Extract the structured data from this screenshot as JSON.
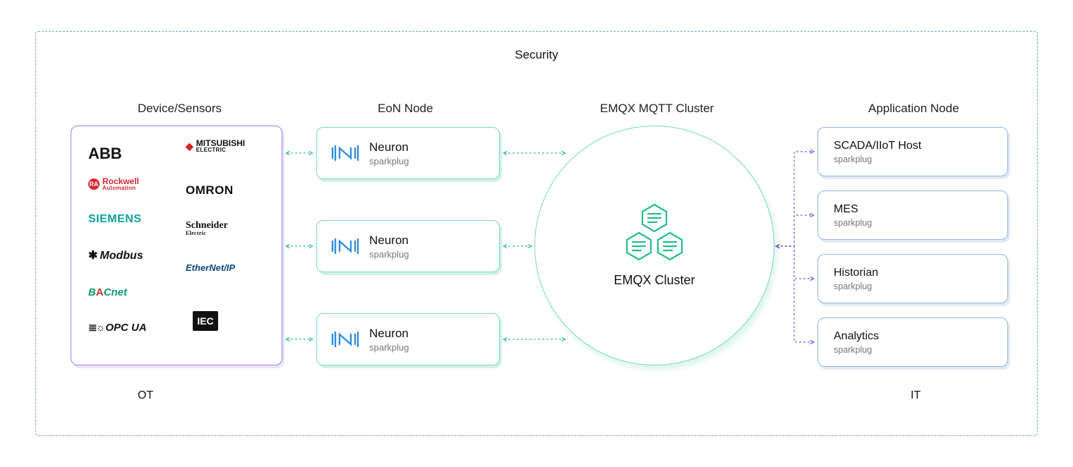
{
  "diagram": {
    "security_title": "Security",
    "columns": {
      "devices": "Device/Sensors",
      "eon": "EoN Node",
      "broker": "EMQX MQTT Cluster",
      "apps": "Application Node"
    },
    "bottom": {
      "ot": "OT",
      "it": "IT"
    },
    "devices": {
      "vendors": {
        "abb": "ABB",
        "mitsubishi_line1": "MITSUBISHI",
        "mitsubishi_line2": "ELECTRIC",
        "rockwell_line1": "Rockwell",
        "rockwell_line2": "Automation",
        "rockwell_badge": "RA",
        "omron": "OMRON",
        "siemens": "SIEMENS",
        "schneider_line1": "Schneider",
        "schneider_line2": "Electric",
        "modbus": "Modbus",
        "ethernetip": "EtherNet/IP",
        "bacnet_pre": "B",
        "bacnet_a": "A",
        "bacnet_post": "Cnet",
        "opcua": "OPC UA",
        "iec": "IEC"
      }
    },
    "eon_nodes": [
      {
        "name": "Neuron",
        "tag": "sparkplug"
      },
      {
        "name": "Neuron",
        "tag": "sparkplug"
      },
      {
        "name": "Neuron",
        "tag": "sparkplug"
      }
    ],
    "broker": {
      "label": "EMQX Cluster"
    },
    "apps": [
      {
        "name": "SCADA/IIoT Host",
        "tag": "sparkplug"
      },
      {
        "name": "MES",
        "tag": "sparkplug"
      },
      {
        "name": "Historian",
        "tag": "sparkplug"
      },
      {
        "name": "Analytics",
        "tag": "sparkplug"
      }
    ]
  }
}
